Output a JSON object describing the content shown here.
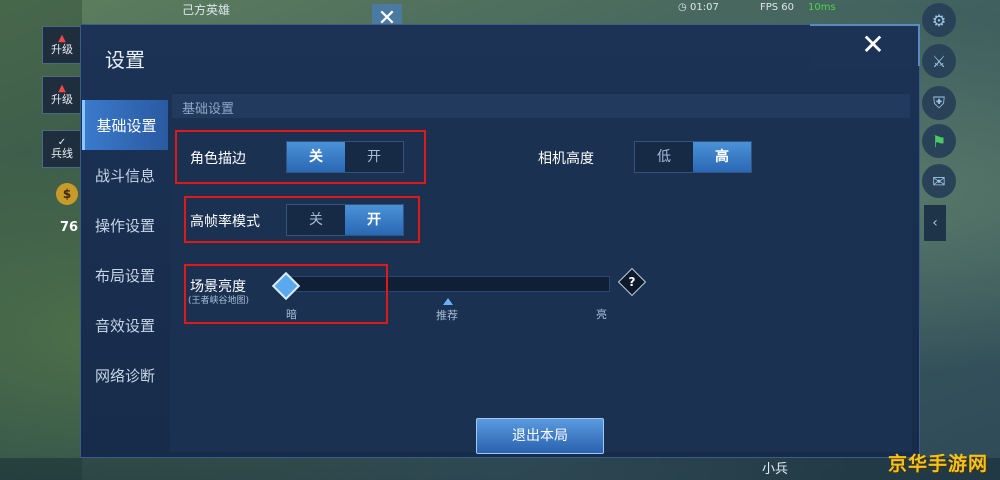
{
  "hud": {
    "upgrade_1": "升级",
    "upgrade_2": "升级",
    "soldier_line": "兵线",
    "gold": "76",
    "coin_symbol": "$",
    "top_hero": "己方英雄",
    "time": "01:07",
    "fps": "FPS 60",
    "ping": "10ms",
    "minion": "小兵",
    "right_buttons": [
      "gear-icon",
      "sword-icon",
      "shield-icon",
      "flag-icon",
      "chat-icon"
    ]
  },
  "panel": {
    "title": "设置",
    "close_glyph": "✕"
  },
  "sidebar": {
    "items": [
      {
        "label": "基础设置",
        "active": true
      },
      {
        "label": "战斗信息",
        "active": false
      },
      {
        "label": "操作设置",
        "active": false
      },
      {
        "label": "布局设置",
        "active": false
      },
      {
        "label": "音效设置",
        "active": false
      },
      {
        "label": "网络诊断",
        "active": false
      }
    ]
  },
  "content": {
    "section_title": "基础设置",
    "outline": {
      "label": "角色描边",
      "off": "关",
      "on": "开",
      "selected": "关"
    },
    "camera": {
      "label": "相机高度",
      "low": "低",
      "high": "高",
      "selected": "高"
    },
    "hfr": {
      "label": "高帧率模式",
      "off": "关",
      "on": "开",
      "selected": "开"
    },
    "brightness": {
      "label": "场景亮度",
      "sublabel": "(王者峡谷地图)",
      "dark": "暗",
      "recommend": "推荐",
      "bright": "亮",
      "help": "?",
      "value": 0
    },
    "exit_button": "退出本局"
  },
  "colors": {
    "highlight": "#e01818",
    "accent": "#3a7acc",
    "watermark": "#f6c21a"
  },
  "watermark": "京华手游网"
}
